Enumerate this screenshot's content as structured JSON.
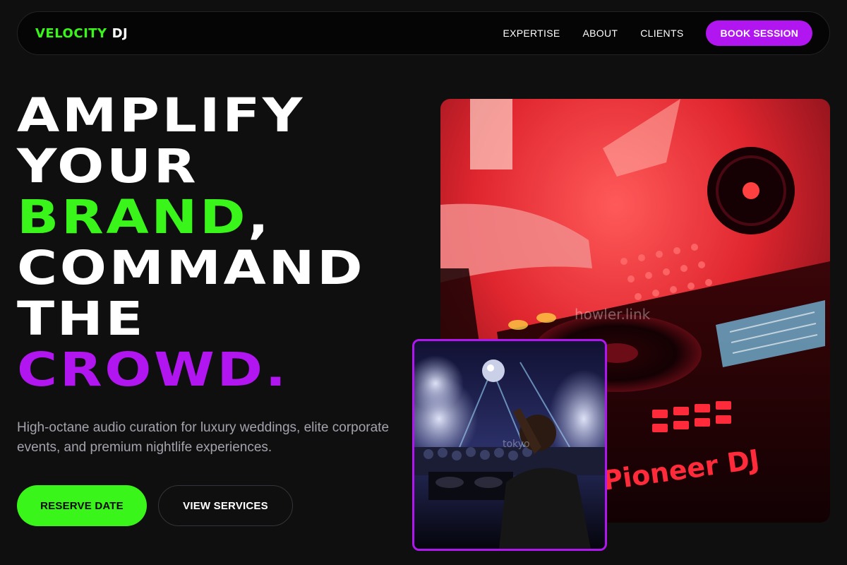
{
  "brand": {
    "accent": "VELOCITY",
    "rest": "DJ"
  },
  "nav": {
    "links": [
      "EXPERTISE",
      "ABOUT",
      "CLIENTS"
    ],
    "cta": "BOOK SESSION"
  },
  "hero": {
    "lines": [
      "AMPLIFY",
      "YOUR",
      "BRAND",
      ",",
      "COMMAND",
      "THE",
      "CROWD",
      "."
    ],
    "subtitle": "High-octane audio curation for luxury weddings, elite corporate events, and premium nightlife experiences.",
    "primary_button": "RESERVE DATE",
    "secondary_button": "VIEW SERVICES"
  },
  "images": {
    "main_icon": "dj-turntable-photo",
    "main_brand_text": "Pioneer DJ",
    "main_watermark": "howler.link",
    "inset_icon": "club-crowd-photo",
    "inset_watermark": "tokyo"
  },
  "colors": {
    "accent_green": "#39f51a",
    "accent_purple": "#b216f0",
    "background": "#0f0f10"
  }
}
